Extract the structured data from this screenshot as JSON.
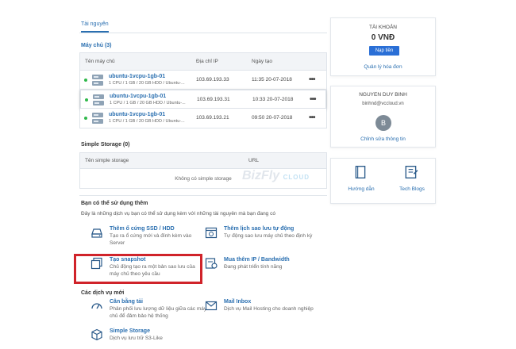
{
  "tab": {
    "label": "Tài nguyên"
  },
  "vms": {
    "title": "Máy chủ (3)",
    "columns": [
      "Tên máy chủ",
      "Địa chỉ IP",
      "Ngày tạo"
    ],
    "rows": [
      {
        "name": "ubuntu-1vcpu-1gb-01",
        "spec": "1 CPU / 1 GB / 20 GB HDD / Ubuntu-...",
        "ip": "103.69.193.33",
        "date": "11:35 20-07-2018"
      },
      {
        "name": "ubuntu-1vcpu-1gb-01",
        "spec": "1 CPU / 1 GB / 20 GB HDD / Ubuntu-...",
        "ip": "103.69.193.31",
        "date": "10:33 20-07-2018"
      },
      {
        "name": "ubuntu-1vcpu-1gb-01",
        "spec": "1 CPU / 1 GB / 20 GB HDD / Ubuntu-...",
        "ip": "103.69.193.21",
        "date": "09:50 20-07-2018"
      }
    ],
    "menu_glyph": "•••"
  },
  "storage": {
    "title": "Simple Storage (0)",
    "columns": [
      "Tên simple storage",
      "URL"
    ],
    "empty": "Không có simple storage"
  },
  "watermark": {
    "text": "BizFly",
    "sub": "CLOUD"
  },
  "extra": {
    "title": "Bạn có thể sử dụng thêm",
    "subtitle": "Đây là những dịch vụ bạn có thể sử dụng kèm với những tài nguyên mà bạn đang có",
    "items": [
      {
        "title": "Thêm ổ cứng SSD / HDD",
        "desc": "Tạo ra ổ cứng mới và đính kèm vào Server",
        "icon": "hard-drive-icon"
      },
      {
        "title": "Thêm lịch sao lưu tự động",
        "desc": "Tự động sao lưu máy chủ theo định kỳ",
        "icon": "backup-calendar-icon"
      },
      {
        "title": "Tạo snapshot",
        "desc": "Chủ động tạo ra một bản sao lưu của máy chủ theo yêu cầu",
        "icon": "snapshot-icon"
      },
      {
        "title": "Mua thêm IP / Bandwidth",
        "desc": "Đang phát triển tính năng",
        "icon": "ip-bandwidth-icon"
      }
    ]
  },
  "new_services": {
    "title": "Các dịch vụ mới",
    "items": [
      {
        "title": "Cân bằng tải",
        "desc": "Phân phối lưu lượng dữ liệu giữa các máy chủ để đảm bảo hệ thống",
        "icon": "load-balancer-icon"
      },
      {
        "title": "Mail Inbox",
        "desc": "Dịch vụ Mail Hosting cho doanh nghiệp",
        "icon": "mail-icon"
      },
      {
        "title": "Simple Storage",
        "desc": "Dịch vụ lưu trữ S3-Like",
        "icon": "storage-cube-icon"
      }
    ]
  },
  "account": {
    "title": "TÀI KHOẢN",
    "balance": "0 VNĐ",
    "topup_label": "Nạp tiền",
    "invoice_link": "Quản lý hóa đơn"
  },
  "user": {
    "name": "NGUYEN DUY BINH",
    "email": "binhnd@vccloud.vn",
    "avatar_letter": "B",
    "edit_link": "Chỉnh sửa thông tin"
  },
  "help": {
    "guide_label": "Hướng dẫn",
    "blog_label": "Tech Blogs"
  },
  "colors": {
    "accent": "#2a6fb0",
    "button": "#2a6fd6",
    "online": "#2fb84a",
    "highlight": "#d0232a"
  }
}
